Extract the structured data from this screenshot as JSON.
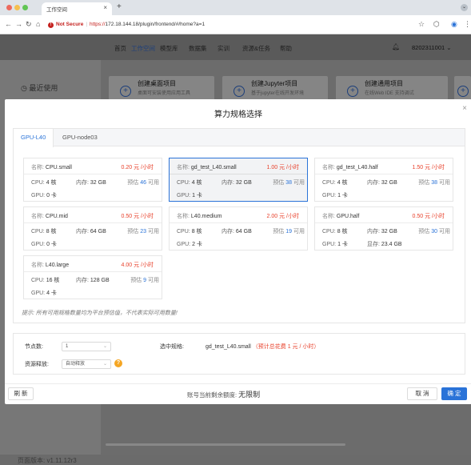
{
  "browser": {
    "tab_title": "工作空间",
    "not_secure": "Not Secure",
    "url_scheme": "https://",
    "url_rest": "172.18.144.18/plugin/frontend/#/home?a=1"
  },
  "topnav": {
    "items": [
      "首页",
      "工作空间",
      "模型库",
      "数据集",
      "实训",
      "资源&任务",
      "帮助"
    ],
    "active_index": 1,
    "user": "8202311001"
  },
  "sidebar": {
    "recent": "最近使用",
    "version": "页面版本: v1.11.12r3"
  },
  "create_cards": [
    {
      "title": "创建桌面项目",
      "desc": "桌面可安装使用应用工具"
    },
    {
      "title": "创建Jupyter项目",
      "desc": "基于jupyter在线开发环境"
    },
    {
      "title": "创建通用项目",
      "desc": "在线Web IDE 支持调试"
    }
  ],
  "modal": {
    "title": "算力规格选择",
    "tabs": [
      "GPU-L40",
      "GPU-node03"
    ],
    "active_tab": 0,
    "labels": {
      "name": "名称:",
      "cpu": "CPU:",
      "mem": "内存:",
      "gpu": "GPU:",
      "vram": "显存:",
      "est": "预估",
      "available": "可用"
    },
    "specs": [
      {
        "name": "CPU.small",
        "price": "0.20 元 /小时",
        "cpu": "4 核",
        "mem": "32 GB",
        "est": "46",
        "gpu": "0 卡",
        "selected": false
      },
      {
        "name": "gd_test_L40.small",
        "price": "1.00 元 /小时",
        "cpu": "4 核",
        "mem": "32 GB",
        "est": "38",
        "gpu": "1 卡",
        "selected": true
      },
      {
        "name": "gd_test_L40.half",
        "price": "1.50 元 /小时",
        "cpu": "4 核",
        "mem": "32 GB",
        "est": "38",
        "gpu": "1 卡",
        "selected": false
      },
      {
        "name": "CPU.mid",
        "price": "0.50 元 /小时",
        "cpu": "8 核",
        "mem": "64 GB",
        "est": "23",
        "gpu": "0 卡",
        "selected": false
      },
      {
        "name": "L40.medium",
        "price": "2.00 元 /小时",
        "cpu": "8 核",
        "mem": "64 GB",
        "est": "19",
        "gpu": "2 卡",
        "selected": false
      },
      {
        "name": "GPU.half",
        "price": "0.50 元 /小时",
        "cpu": "8 核",
        "mem": "32 GB",
        "est": "30",
        "gpu": "1 卡",
        "vram": "23.4 GB",
        "selected": false
      },
      {
        "name": "L40.large",
        "price": "4.00 元 /小时",
        "cpu": "16 核",
        "mem": "128 GB",
        "est": "9",
        "gpu": "4 卡",
        "selected": false
      }
    ],
    "hint": "提示: 所有可用规格数量均为平台预估值，不代表实际可用数量!",
    "node_count_label": "节点数:",
    "node_count_value": "1",
    "release_label": "资源释放:",
    "release_value": "自动释放",
    "selected_spec_label": "选中规格:",
    "selected_spec_name": "gd_test_L40.small",
    "selected_spec_cost": "（预计总花费 1 元 / 小时）",
    "quota_label": "账号当前剩余额度: ",
    "quota_value": "无限制",
    "refresh_label": "刷 新",
    "cancel_label": "取 消",
    "ok_label": "确 定"
  }
}
